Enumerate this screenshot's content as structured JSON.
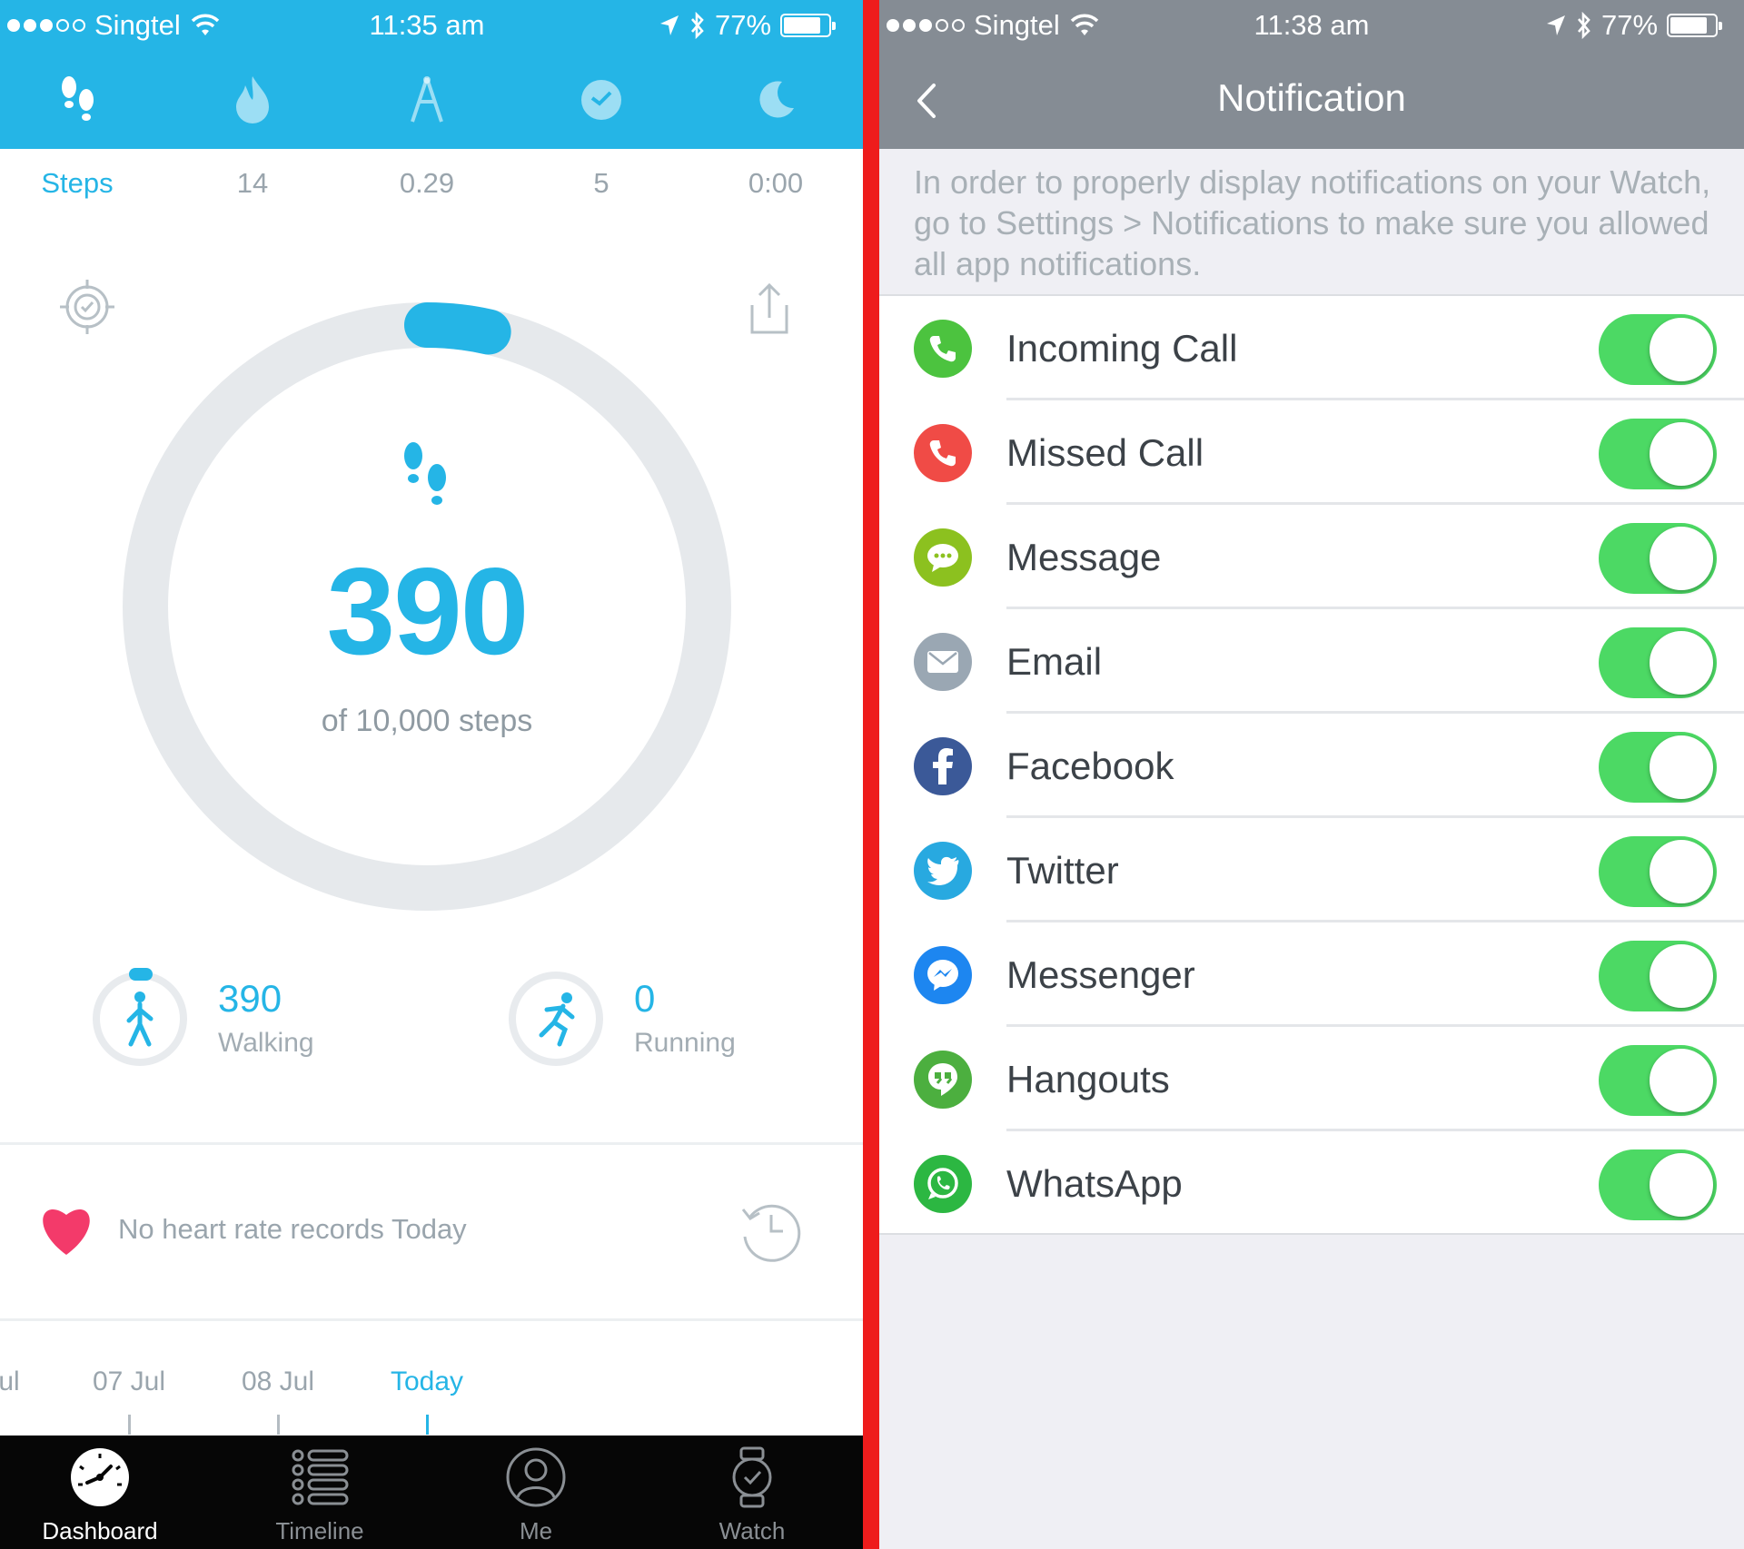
{
  "left": {
    "status_bar": {
      "carrier": "Singtel",
      "time": "11:35 am",
      "battery": "77%"
    },
    "header_tabs": [
      "steps-icon",
      "flame-icon",
      "distance-icon",
      "clock-icon",
      "moon-icon"
    ],
    "metrics": [
      {
        "label": "Steps",
        "active": true
      },
      {
        "label": "14"
      },
      {
        "label": "0.29"
      },
      {
        "label": "5"
      },
      {
        "label": "0:00"
      }
    ],
    "steps": {
      "count": "390",
      "goal_text": "of 10,000 steps",
      "progress": 0.039
    },
    "walking": {
      "value": "390",
      "label": "Walking"
    },
    "running": {
      "value": "0",
      "label": "Running"
    },
    "heart": {
      "text": "No heart rate records Today"
    },
    "dates": [
      {
        "label": "ul"
      },
      {
        "label": "07 Jul"
      },
      {
        "label": "08 Jul"
      },
      {
        "label": "Today",
        "active": true
      }
    ],
    "bottom_nav": [
      {
        "label": "Dashboard",
        "active": true
      },
      {
        "label": "Timeline"
      },
      {
        "label": "Me"
      },
      {
        "label": "Watch"
      }
    ]
  },
  "right": {
    "status_bar": {
      "carrier": "Singtel",
      "time": "11:38 am",
      "battery": "77%"
    },
    "title": "Notification",
    "info": "In order to properly display notifications on your Watch, go to Settings > Notifications to make sure you allowed all app notifications.",
    "items": [
      {
        "label": "Incoming Call",
        "icon": "phone-icon",
        "color": "#4cc33f",
        "enabled": true
      },
      {
        "label": "Missed Call",
        "icon": "phone-icon",
        "color": "#f04b46",
        "enabled": true
      },
      {
        "label": "Message",
        "icon": "chat-bubble-icon",
        "color": "#8cc11f",
        "enabled": true
      },
      {
        "label": "Email",
        "icon": "envelope-icon",
        "color": "#9aa7b3",
        "enabled": true
      },
      {
        "label": "Facebook",
        "icon": "facebook-icon",
        "color": "#3b5998",
        "enabled": true
      },
      {
        "label": "Twitter",
        "icon": "twitter-bird-icon",
        "color": "#28a9e0",
        "enabled": true
      },
      {
        "label": "Messenger",
        "icon": "messenger-icon",
        "color": "#1d86f0",
        "enabled": true
      },
      {
        "label": "Hangouts",
        "icon": "hangouts-quote-icon",
        "color": "#4caf3f",
        "enabled": true
      },
      {
        "label": "WhatsApp",
        "icon": "whatsapp-icon",
        "color": "#2cb742",
        "enabled": true
      }
    ]
  },
  "colors": {
    "accent": "#25b5e6",
    "toggle_on": "#4cd964",
    "divider": "#ee1c1c",
    "nav_gray": "#858c94"
  }
}
